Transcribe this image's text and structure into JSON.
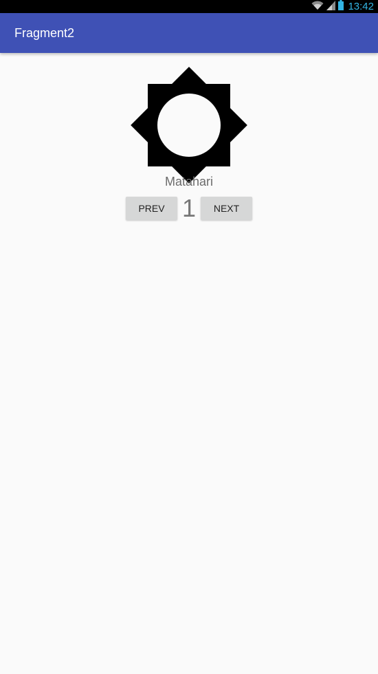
{
  "status_bar": {
    "time": "13:42",
    "icons": [
      "wifi-icon",
      "signal-icon",
      "battery-icon"
    ],
    "time_color": "#33b5e5"
  },
  "app_bar": {
    "title": "Fragment2",
    "color": "#3f51b5"
  },
  "content": {
    "image_icon": "sun-icon",
    "caption": "Matahari",
    "prev_label": "PREV",
    "page_number": "1",
    "next_label": "NEXT"
  }
}
